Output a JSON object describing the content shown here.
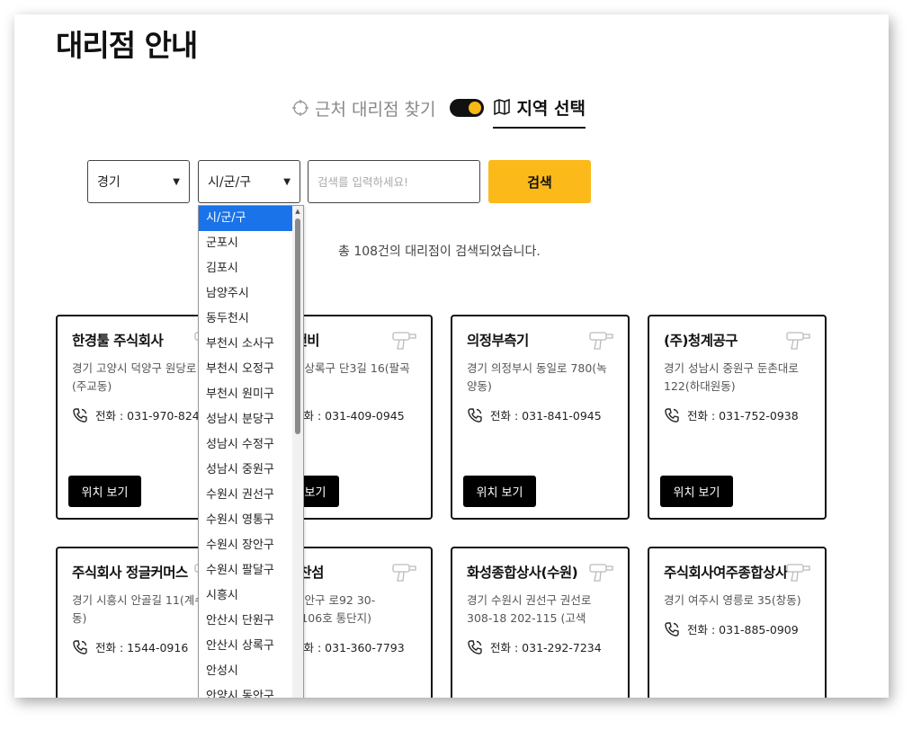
{
  "page": {
    "title": "대리점 안내"
  },
  "mode": {
    "nearby_label": "근처 대리점 찾기",
    "region_label": "지역 선택",
    "toggle_on": true
  },
  "filters": {
    "province_value": "경기",
    "city_value": "시/군/구",
    "search_placeholder": "검색를 입력하세요!",
    "search_button": "검색"
  },
  "result": {
    "count_text": "총 108건의 대리점이 검색되었습니다."
  },
  "dropdown": {
    "items": [
      "시/군/구",
      "군포시",
      "김포시",
      "남양주시",
      "동두천시",
      "부천시 소사구",
      "부천시 오정구",
      "부천시 원미구",
      "성남시 분당구",
      "성남시 수정구",
      "성남시 중원구",
      "수원시 권선구",
      "수원시 영통구",
      "수원시 장안구",
      "수원시 팔달구",
      "시흥시",
      "안산시 단원구",
      "안산시 상록구",
      "안성시",
      "안양시 동안구"
    ],
    "selected_index": 0
  },
  "cards": [
    {
      "name": "한경툴 주식회사",
      "address": "경기 고양시 덕양구 원당로 1층(주교동)",
      "phone": "전화 : 031-970-8244",
      "button": "위치 보기"
    },
    {
      "name": "국이앤비",
      "address": "안산시 상록구 단3길 16(팔곡이동)",
      "phone": "전화 : 031-409-0945",
      "button": "위치 보기"
    },
    {
      "name": "의정부측기",
      "address": "경기 의정부시 동일로 780(녹양동)",
      "phone": "전화 : 031-841-0945",
      "button": "위치 보기"
    },
    {
      "name": "(주)청계공구",
      "address": "경기 성남시 중원구 둔촌대로 122(하대원동)",
      "phone": "전화 : 031-752-0938",
      "button": "위치 보기"
    },
    {
      "name": "주식회사 정글커머스",
      "address": "경기 시흥시 안골길 11(계수동)",
      "phone": "전화 : 1544-0916",
      "button": "위치 보기"
    },
    {
      "name": "회사 찬섬",
      "address": "양시 동안구 로92 30-105~106호 통단지)",
      "phone": "전화 : 031-360-7793",
      "button": "위치 보기"
    },
    {
      "name": "화성종합상사(수원)",
      "address": "경기 수원시 권선구 권선로 308-18 202-115 (고색",
      "phone": "전화 : 031-292-7234",
      "button": "위치 보기"
    },
    {
      "name": "주식회사여주종합상사",
      "address": "경기 여주시 영릉로 35(창동)",
      "phone": "전화 : 031-885-0909",
      "button": "위치 보기"
    }
  ],
  "icons": {
    "target": "crosshair-icon",
    "map": "map-icon",
    "phone": "phone-icon",
    "tool": "power-tool-icon"
  },
  "colors": {
    "accent": "#fbb91a",
    "dark": "#111111",
    "selected": "#1a73e8"
  }
}
